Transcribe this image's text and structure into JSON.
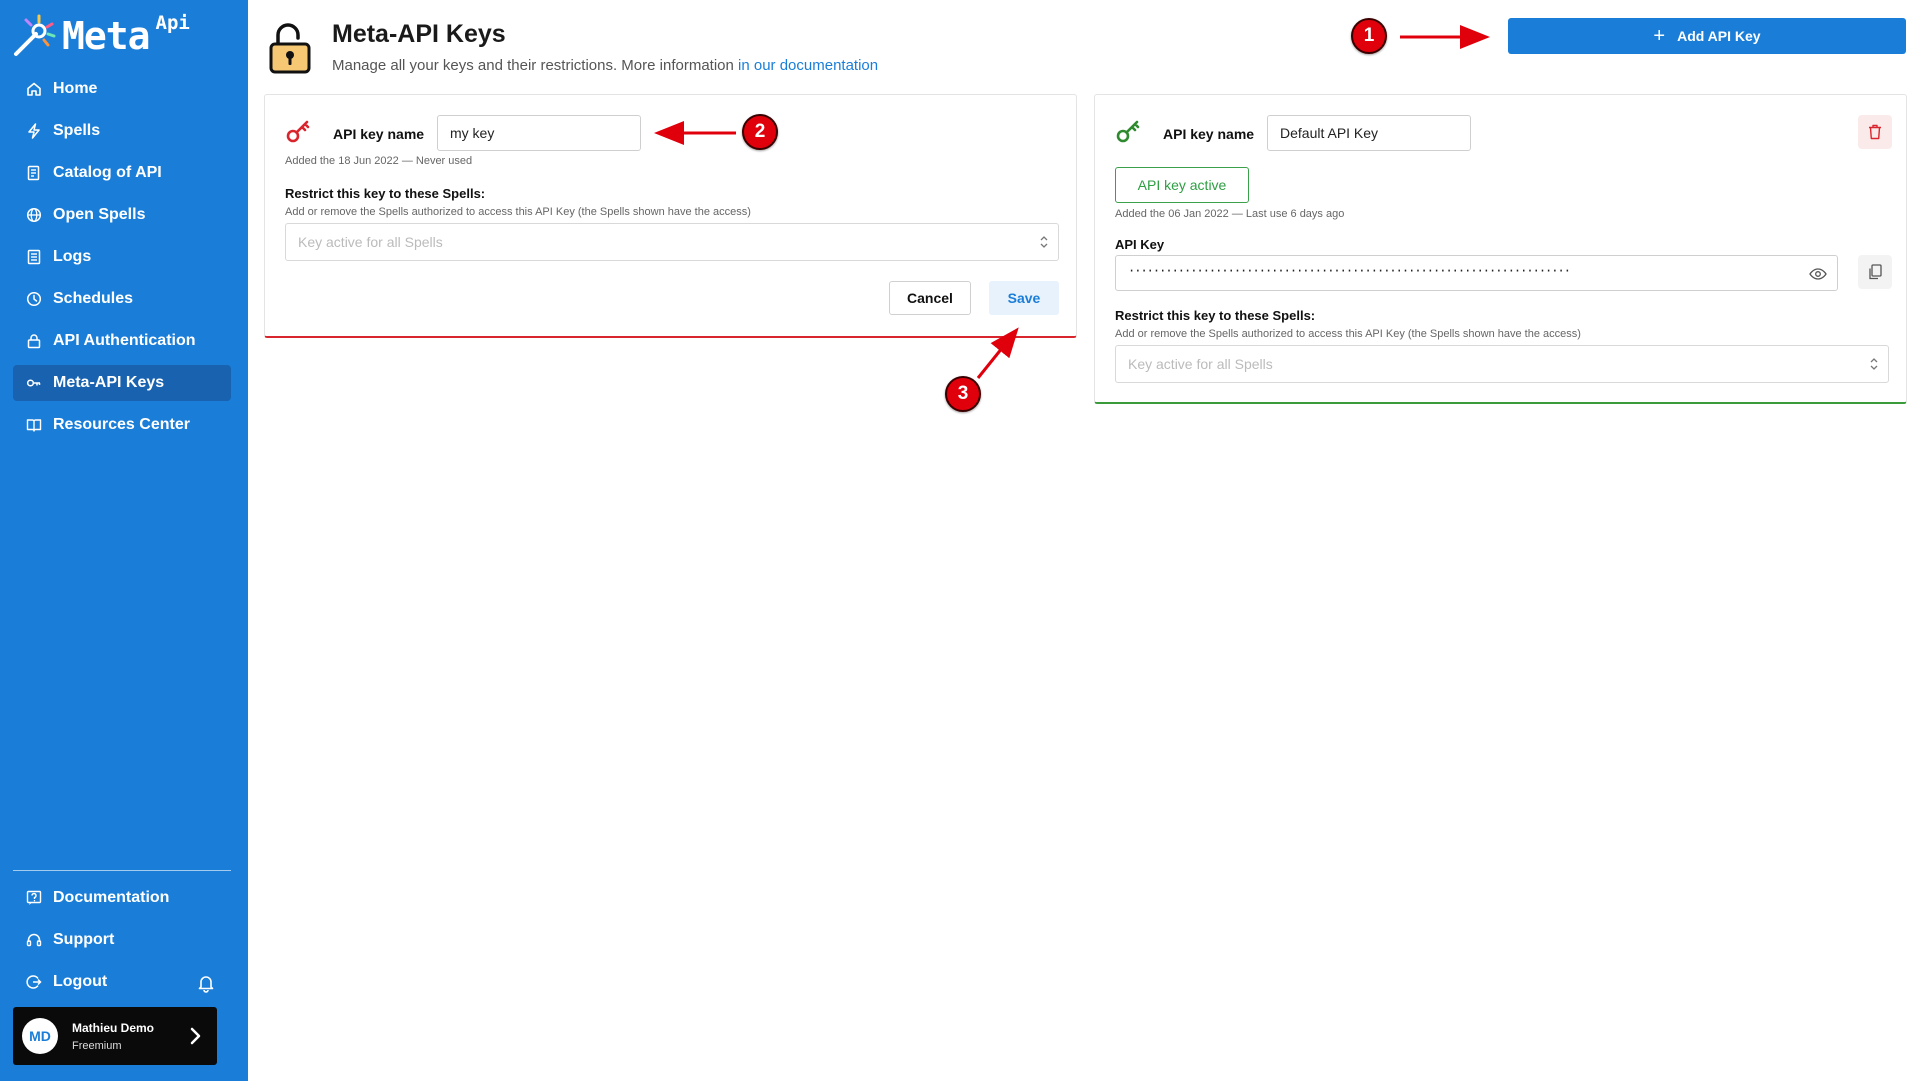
{
  "app": {
    "logo_text": "Meta",
    "logo_superscript": "Api"
  },
  "sidebar": {
    "items": [
      {
        "label": "Home",
        "icon": "home-icon",
        "active": false
      },
      {
        "label": "Spells",
        "icon": "bolt-icon",
        "active": false
      },
      {
        "label": "Catalog of API",
        "icon": "catalog-icon",
        "active": false
      },
      {
        "label": "Open Spells",
        "icon": "globe-icon",
        "active": false
      },
      {
        "label": "Logs",
        "icon": "logs-icon",
        "active": false
      },
      {
        "label": "Schedules",
        "icon": "clock-icon",
        "active": false
      },
      {
        "label": "API Authentication",
        "icon": "lock-icon",
        "active": false
      },
      {
        "label": "Meta-API Keys",
        "icon": "key-icon",
        "active": true
      },
      {
        "label": "Resources Center",
        "icon": "book-icon",
        "active": false
      }
    ],
    "bottom_items": [
      {
        "label": "Documentation",
        "icon": "help-icon"
      },
      {
        "label": "Support",
        "icon": "headset-icon"
      },
      {
        "label": "Logout",
        "icon": "logout-icon"
      }
    ],
    "user": {
      "initials": "MD",
      "name": "Mathieu Demo",
      "plan": "Freemium"
    }
  },
  "header": {
    "title": "Meta-API Keys",
    "subtitle": "Manage all your keys and their restrictions. More information ",
    "doc_link": "in our documentation",
    "add_button": "Add API Key"
  },
  "new_key_card": {
    "name_label": "API key name",
    "name_value": "my key",
    "added_text": "Added the 18 Jun 2022 — Never used",
    "restrict_label": "Restrict this key to these Spells:",
    "restrict_help": "Add or remove the Spells authorized to access this API Key (the Spells shown have the access)",
    "spells_placeholder": "Key active for all Spells",
    "cancel_label": "Cancel",
    "save_label": "Save"
  },
  "default_key_card": {
    "name_label": "API key name",
    "name_value": "Default API Key",
    "status_label": "API key active",
    "added_text": "Added the 06 Jan 2022 — Last use 6 days ago",
    "api_key_label": "API Key",
    "api_key_masked": "·······································································",
    "restrict_label": "Restrict this key to these Spells:",
    "restrict_help": "Add or remove the Spells authorized to access this API Key (the Spells shown have the access)",
    "spells_placeholder": "Key active for all Spells"
  },
  "annotations": [
    "1",
    "2",
    "3"
  ],
  "colors": {
    "sidebar": "#1a7ed8",
    "sidebar_active": "#1862b0",
    "primary": "#1a7ed8",
    "danger": "#d9262e",
    "success": "#3a9b3a",
    "annotation": "#e0000c"
  }
}
